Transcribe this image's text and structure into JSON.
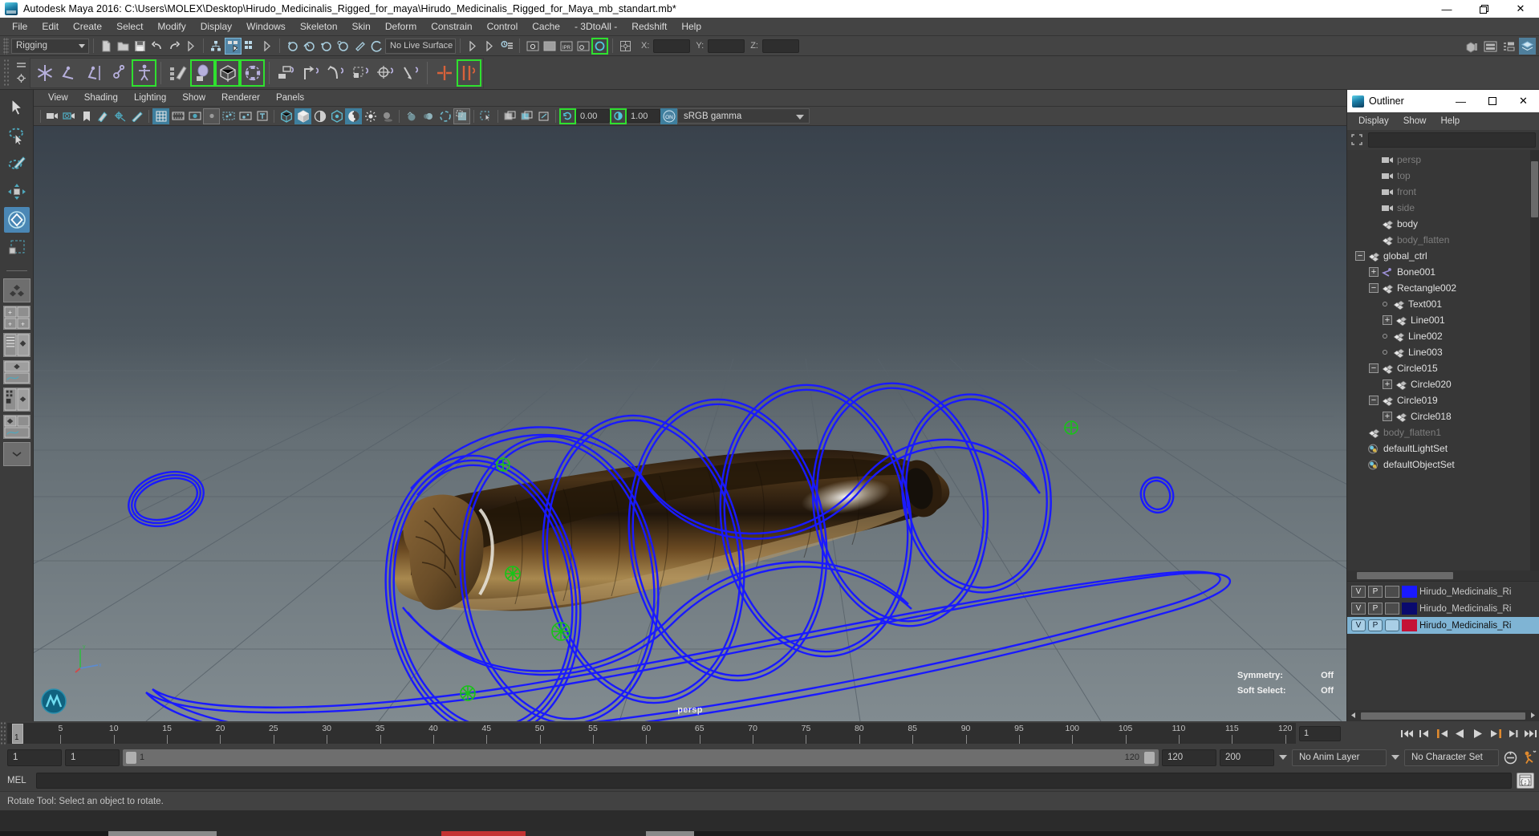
{
  "window": {
    "title": "Autodesk Maya 2016: C:\\Users\\MOLEX\\Desktop\\Hirudo_Medicinalis_Rigged_for_maya\\Hirudo_Medicinalis_Rigged_for_Maya_mb_standart.mb*",
    "minimize": "—",
    "maximize": "❐",
    "close": "✕"
  },
  "menubar": {
    "items": [
      "File",
      "Edit",
      "Create",
      "Select",
      "Modify",
      "Display",
      "Windows",
      "Skeleton",
      "Skin",
      "Deform",
      "Constrain",
      "Control",
      "Cache",
      "- 3DtoAll -",
      "Redshift",
      "Help"
    ]
  },
  "statusline": {
    "mode_selector": "Rigging",
    "live_surface": "No Live Surface",
    "coord_labels": {
      "x": "X:",
      "y": "Y:",
      "z": "Z:"
    },
    "coord_values": {
      "x": "",
      "y": "",
      "z": ""
    }
  },
  "viewport_panel": {
    "menus": [
      "View",
      "Shading",
      "Lighting",
      "Show",
      "Renderer",
      "Panels"
    ],
    "exposure": "0.00",
    "gamma": "1.00",
    "color_profile": "sRGB gamma",
    "hud": {
      "camera": "persp",
      "symmetry_label": "Symmetry:",
      "symmetry_value": "Off",
      "soft_select_label": "Soft Select:",
      "soft_select_value": "Off"
    }
  },
  "outliner": {
    "title": "Outliner",
    "minimize": "—",
    "maximize": "❐",
    "close": "✕",
    "menus": [
      "Display",
      "Show",
      "Help"
    ],
    "search_value": "",
    "tree": [
      {
        "label": "persp",
        "indent": 1,
        "icon": "camera-icon",
        "expander": "none",
        "dim": true
      },
      {
        "label": "top",
        "indent": 1,
        "icon": "camera-icon",
        "expander": "none",
        "dim": true
      },
      {
        "label": "front",
        "indent": 1,
        "icon": "camera-icon",
        "expander": "none",
        "dim": true
      },
      {
        "label": "side",
        "indent": 1,
        "icon": "camera-icon",
        "expander": "none",
        "dim": true
      },
      {
        "label": "body",
        "indent": 1,
        "icon": "mesh-icon",
        "expander": "none",
        "dim": false
      },
      {
        "label": "body_flatten",
        "indent": 1,
        "icon": "mesh-icon",
        "expander": "none",
        "dim": true
      },
      {
        "label": "global_ctrl",
        "indent": 0,
        "icon": "mesh-icon",
        "expander": "minus",
        "dim": false
      },
      {
        "label": "Bone001",
        "indent": 1,
        "icon": "joint-icon",
        "expander": "plus",
        "dim": false
      },
      {
        "label": "Rectangle002",
        "indent": 1,
        "icon": "mesh-icon",
        "expander": "minus",
        "dim": false
      },
      {
        "label": "Text001",
        "indent": 2,
        "icon": "mesh-icon",
        "expander": "dot",
        "dim": false
      },
      {
        "label": "Line001",
        "indent": 2,
        "icon": "mesh-icon",
        "expander": "plus",
        "dim": false
      },
      {
        "label": "Line002",
        "indent": 2,
        "icon": "mesh-icon",
        "expander": "dot",
        "dim": false
      },
      {
        "label": "Line003",
        "indent": 2,
        "icon": "mesh-icon",
        "expander": "dot",
        "dim": false
      },
      {
        "label": "Circle015",
        "indent": 1,
        "icon": "mesh-icon",
        "expander": "minus",
        "dim": false
      },
      {
        "label": "Circle020",
        "indent": 2,
        "icon": "mesh-icon",
        "expander": "plus",
        "dim": false
      },
      {
        "label": "Circle019",
        "indent": 1,
        "icon": "mesh-icon",
        "expander": "minus",
        "dim": false
      },
      {
        "label": "Circle018",
        "indent": 2,
        "icon": "mesh-icon",
        "expander": "plus",
        "dim": false
      },
      {
        "label": "body_flatten1",
        "indent": 0,
        "icon": "mesh-icon",
        "expander": "none",
        "dim": true
      },
      {
        "label": "defaultLightSet",
        "indent": 0,
        "icon": "set-icon",
        "expander": "none",
        "dim": false
      },
      {
        "label": "defaultObjectSet",
        "indent": 0,
        "icon": "set-icon",
        "expander": "none",
        "dim": false
      }
    ]
  },
  "layer_editor": {
    "layers": [
      {
        "v": "V",
        "p": "P",
        "color": "#1a1aff",
        "name": "Hirudo_Medicinalis_Ri",
        "selected": false
      },
      {
        "v": "V",
        "p": "P",
        "color": "#0a0a6e",
        "name": "Hirudo_Medicinalis_Ri",
        "selected": false
      },
      {
        "v": "V",
        "p": "P",
        "color": "#c41236",
        "name": "Hirudo_Medicinalis_Ri",
        "selected": true
      }
    ]
  },
  "time_slider": {
    "tick_labels": [
      "5",
      "10",
      "15",
      "20",
      "25",
      "30",
      "35",
      "40",
      "45",
      "50",
      "55",
      "60",
      "65",
      "70",
      "75",
      "80",
      "85",
      "90",
      "95",
      "100",
      "105",
      "110",
      "115",
      "120"
    ],
    "current_frame_marker": "1",
    "current_frame_field": "1"
  },
  "range_slider": {
    "anim_start": "1",
    "range_start": "1",
    "bar_start_value": "1",
    "bar_end_value": "120",
    "range_end": "120",
    "anim_end": "200",
    "anim_layer": "No Anim Layer",
    "character_set": "No Character Set"
  },
  "command_line": {
    "language": "MEL",
    "value": ""
  },
  "help_line": {
    "message": "Rotate Tool: Select an object to rotate."
  },
  "colors": {
    "accent_blue": "#1a1aff",
    "highlight": "#7fb4d4",
    "shelf_green": "#2fe02f",
    "manipulator_orange": "#e08a2e"
  },
  "chart_data": null
}
